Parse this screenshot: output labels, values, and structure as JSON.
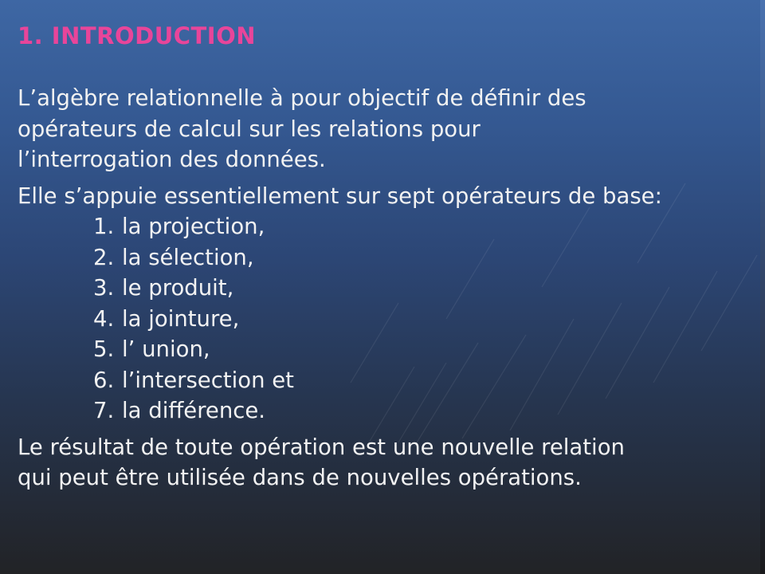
{
  "slide": {
    "title": "1. INTRODUCTION",
    "paragraph1": "L’algèbre relationnelle à pour objectif de définir des opérateurs de calcul sur les relations pour l’interrogation des données.",
    "paragraph1_lines": [
      "L’algèbre relationnelle à pour objectif de définir des",
      "opérateurs de calcul sur les relations pour",
      "l’interrogation des données."
    ],
    "paragraph2": "Elle s’appuie essentiellement sur sept opérateurs de base:",
    "operators": [
      {
        "number": "1.",
        "label": "la projection,"
      },
      {
        "number": "2.",
        "label": "la sélection,"
      },
      {
        "number": "3.",
        "label": "le produit,"
      },
      {
        "number": "4.",
        "label": "la jointure,"
      },
      {
        "number": "5.",
        "label": "l’ union,"
      },
      {
        "number": "6.",
        "label": "l’intersection et"
      },
      {
        "number": "7.",
        "label": "la différence."
      }
    ],
    "paragraph3_lines": [
      "Le résultat de toute opération est une nouvelle relation",
      "qui peut être utilisée dans de nouvelles opérations."
    ]
  },
  "colors": {
    "title": "#e8459a",
    "text": "#f2f2f2",
    "background_top": "#3e67a4",
    "background_bottom": "#222326"
  }
}
